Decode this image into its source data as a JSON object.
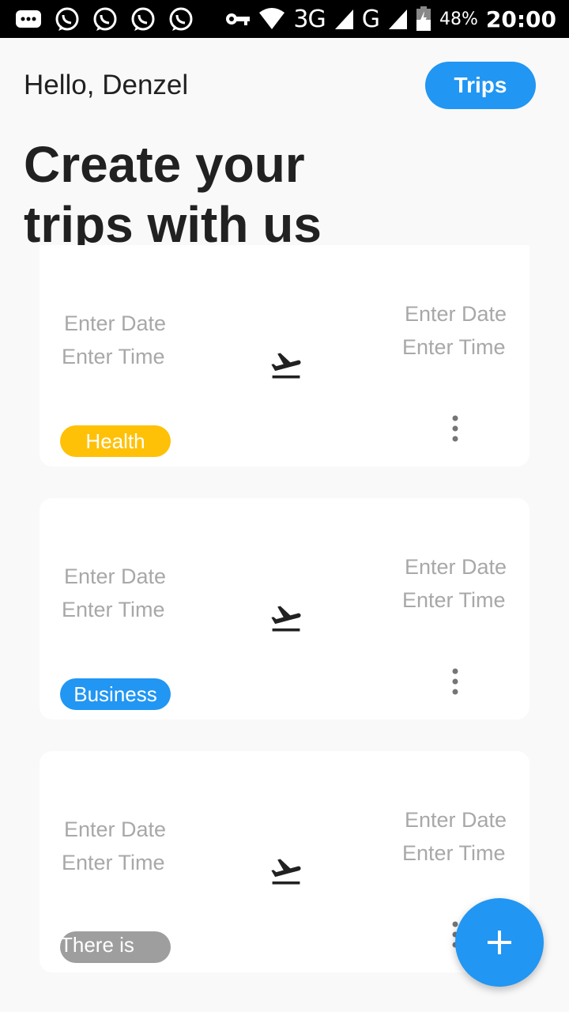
{
  "status_bar": {
    "network": "3G",
    "network2": "G",
    "battery_percent": "48%",
    "time": "20:00",
    "icons": [
      "message-icon",
      "whatsapp-icon",
      "whatsapp-icon",
      "whatsapp-icon",
      "whatsapp-icon",
      "vpn-key-icon",
      "wifi-icon",
      "signal-icon",
      "battery-icon"
    ]
  },
  "header": {
    "greeting": "Hello, Denzel",
    "trips_button": "Trips",
    "title": "Create your trips with us"
  },
  "trips": [
    {
      "departure_date": "Enter Date",
      "departure_time": "Enter Time",
      "arrival_date": "Enter Date",
      "arrival_time": "Enter Time",
      "tag": "Health",
      "tag_color": "#ffc107"
    },
    {
      "departure_date": "Enter Date",
      "departure_time": "Enter Time",
      "arrival_date": "Enter Date",
      "arrival_time": "Enter Time",
      "tag": "Business",
      "tag_color": "#2196f3"
    },
    {
      "departure_date": "Enter Date",
      "departure_time": "Enter Time",
      "arrival_date": "Enter Date",
      "arrival_time": "Enter Time",
      "tag": "There is nothing",
      "tag_color": "#9e9e9e"
    }
  ],
  "colors": {
    "accent": "#2196f3",
    "background": "#f9f9f9"
  }
}
